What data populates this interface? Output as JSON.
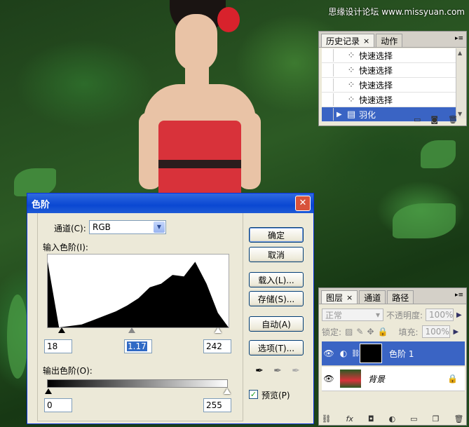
{
  "watermark": "思缘设计论坛 www.missyuan.com",
  "history_panel": {
    "tabs": [
      {
        "label": "历史记录",
        "active": true,
        "closable": true
      },
      {
        "label": "动作",
        "active": false,
        "closable": false
      }
    ],
    "items": [
      {
        "label": "快速选择",
        "icon": "quick-select-icon",
        "selected": false
      },
      {
        "label": "快速选择",
        "icon": "quick-select-icon",
        "selected": false
      },
      {
        "label": "快速选择",
        "icon": "quick-select-icon",
        "selected": false
      },
      {
        "label": "快速选择",
        "icon": "quick-select-icon",
        "selected": false
      },
      {
        "label": "羽化",
        "icon": "feather-icon",
        "selected": true
      }
    ]
  },
  "layers_panel": {
    "tabs": [
      {
        "label": "图层",
        "active": true,
        "closable": true
      },
      {
        "label": "通道",
        "active": false,
        "closable": false
      },
      {
        "label": "路径",
        "active": false,
        "closable": false
      }
    ],
    "blend_mode": "正常",
    "opacity_label": "不透明度:",
    "opacity_value": "100%",
    "lock_label": "锁定:",
    "fill_label": "填充:",
    "fill_value": "100%",
    "layers": [
      {
        "name": "色阶 1",
        "selected": true
      },
      {
        "name": "背景",
        "selected": false,
        "locked": true
      }
    ]
  },
  "levels_dialog": {
    "title": "色阶",
    "channel_label": "通道(C):",
    "channel_value": "RGB",
    "input_label": "输入色阶(I):",
    "input_black": "18",
    "input_gamma": "1.17",
    "input_white": "242",
    "output_label": "输出色阶(O):",
    "output_black": "0",
    "output_white": "255",
    "buttons": {
      "ok": "确定",
      "cancel": "取消",
      "load": "载入(L)...",
      "save": "存储(S)...",
      "auto": "自动(A)",
      "options": "选项(T)..."
    },
    "preview_label": "预览(P)",
    "preview_checked": true
  },
  "chart_data": {
    "type": "area",
    "x": [
      0,
      16,
      32,
      48,
      64,
      80,
      96,
      112,
      128,
      144,
      160,
      176,
      192,
      208,
      224,
      240,
      255
    ],
    "y": [
      90,
      0,
      2,
      4,
      10,
      16,
      22,
      30,
      40,
      55,
      60,
      72,
      70,
      90,
      60,
      20,
      0
    ],
    "xlim": [
      0,
      255
    ],
    "ylim": [
      0,
      100
    ],
    "grid": false
  },
  "colors": {
    "title_bar": "#0a47d2",
    "selection": "#3a64c4"
  }
}
